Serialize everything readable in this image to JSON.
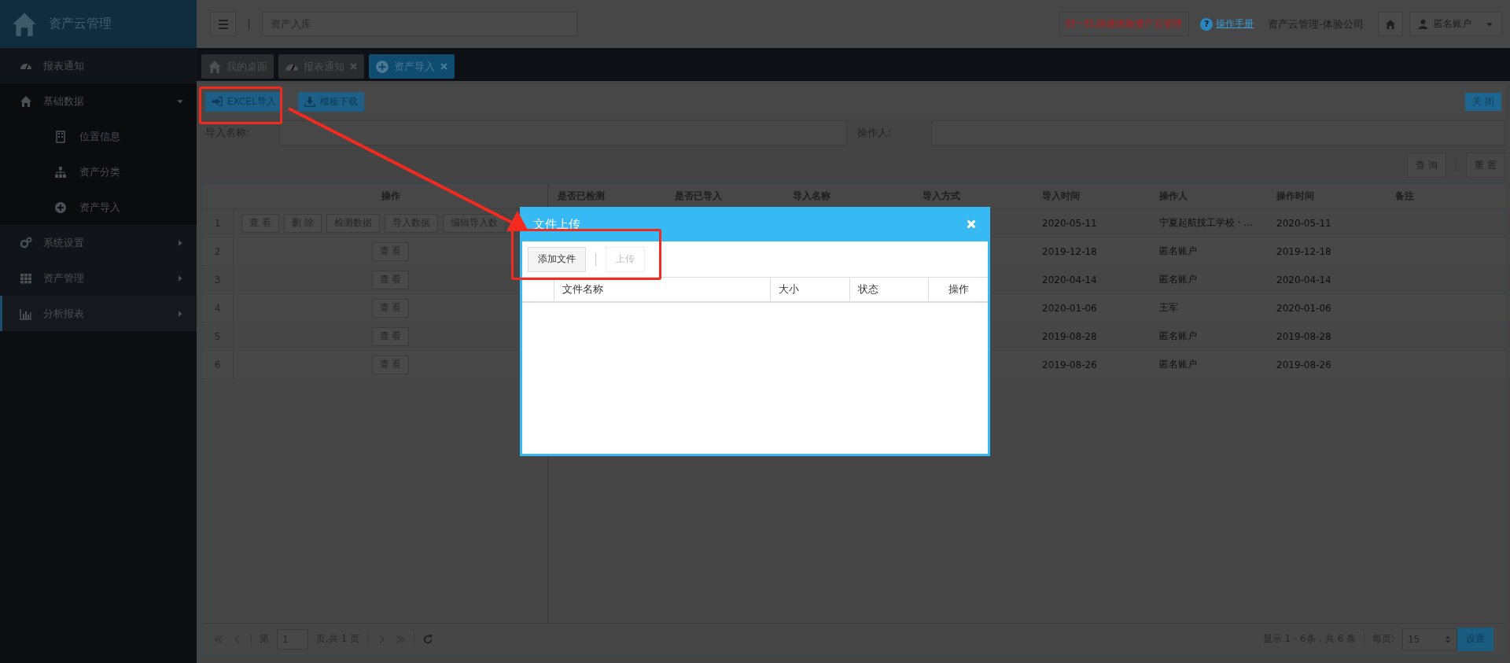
{
  "app": {
    "title": "资产云管理"
  },
  "sidebar": {
    "items": [
      {
        "label": "报表通知",
        "selected": false
      },
      {
        "label": "基础数据",
        "selected": false,
        "expanded": true,
        "children": [
          {
            "label": "位置信息",
            "selected": false
          },
          {
            "label": "资产分类",
            "selected": false
          },
          {
            "label": "资产导入",
            "selected": false
          }
        ]
      },
      {
        "label": "系统设置",
        "selected": false,
        "expanded": false
      },
      {
        "label": "资产管理",
        "selected": false,
        "expanded": false
      },
      {
        "label": "分析报表",
        "selected": true,
        "expanded": false
      }
    ]
  },
  "header": {
    "search": {
      "value": "资产入库"
    },
    "promo_button": "扫一扫,快速体验资产云管理",
    "help_icon": "?",
    "help_link": "操作手册",
    "company": "资产云管理-体验公司",
    "user": "匿名账户"
  },
  "tabs": [
    {
      "label": "我的桌面",
      "selected": false,
      "closable": false
    },
    {
      "label": "报表通知",
      "selected": false,
      "closable": true
    },
    {
      "label": "资产导入",
      "selected": true,
      "closable": true
    }
  ],
  "toolbar": {
    "buttons": [
      "EXCEL导入",
      "模板下载"
    ],
    "close": "关 闭"
  },
  "filters": [
    {
      "label": "导入名称:"
    },
    {
      "label": "操作人:"
    }
  ],
  "filter_buttons": [
    "查 询",
    "重 置"
  ],
  "grid": {
    "columns": [
      "操作",
      "是否已检测",
      "是否已导入",
      "导入名称",
      "导入方式",
      "导入时间",
      "操作人",
      "操作时间",
      "备注"
    ],
    "rows": [
      {
        "number": "1",
        "actions": [
          "查 看",
          "删 除",
          "检测数据",
          "导入数据",
          "编辑导入数"
        ],
        "import_time": "2020-05-11",
        "operator": "宁夏起航技工学校 · ...",
        "operate_time": "2020-05-11"
      },
      {
        "number": "2",
        "actions": [
          "查 看"
        ],
        "import_time": "2019-12-18",
        "operator": "匿名账户",
        "operate_time": "2019-12-18"
      },
      {
        "number": "3",
        "actions": [
          "查 看"
        ],
        "import_time": "2020-04-14",
        "operator": "匿名账户",
        "operate_time": "2020-04-14"
      },
      {
        "number": "4",
        "actions": [
          "查 看"
        ],
        "import_time": "2020-01-06",
        "operator": "王军",
        "operate_time": "2020-01-06"
      },
      {
        "number": "5",
        "actions": [
          "查 看"
        ],
        "import_time": "2019-08-28",
        "operator": "匿名账户",
        "operate_time": "2019-08-28"
      },
      {
        "number": "6",
        "actions": [
          "查 看"
        ],
        "import_time": "2019-08-26",
        "operator": "匿名账户",
        "operate_time": "2019-08-26"
      }
    ]
  },
  "pager": {
    "page_label": "第",
    "page": "1",
    "page_total": "页,共 1 页",
    "summary": "显示 1 - 6条，共 6 条",
    "per_page_label": "每页:",
    "per_page": "15",
    "apply": "设置"
  },
  "modal": {
    "title": "文件上传",
    "buttons": [
      {
        "label": "添加文件",
        "disabled": false
      },
      {
        "label": "上传",
        "disabled": true
      }
    ],
    "columns": [
      "文件名称",
      "大小",
      "状态",
      "操作"
    ]
  },
  "callouts": [
    {
      "kind": "frame"
    },
    {
      "kind": "frame"
    },
    {
      "kind": "arrow"
    }
  ]
}
